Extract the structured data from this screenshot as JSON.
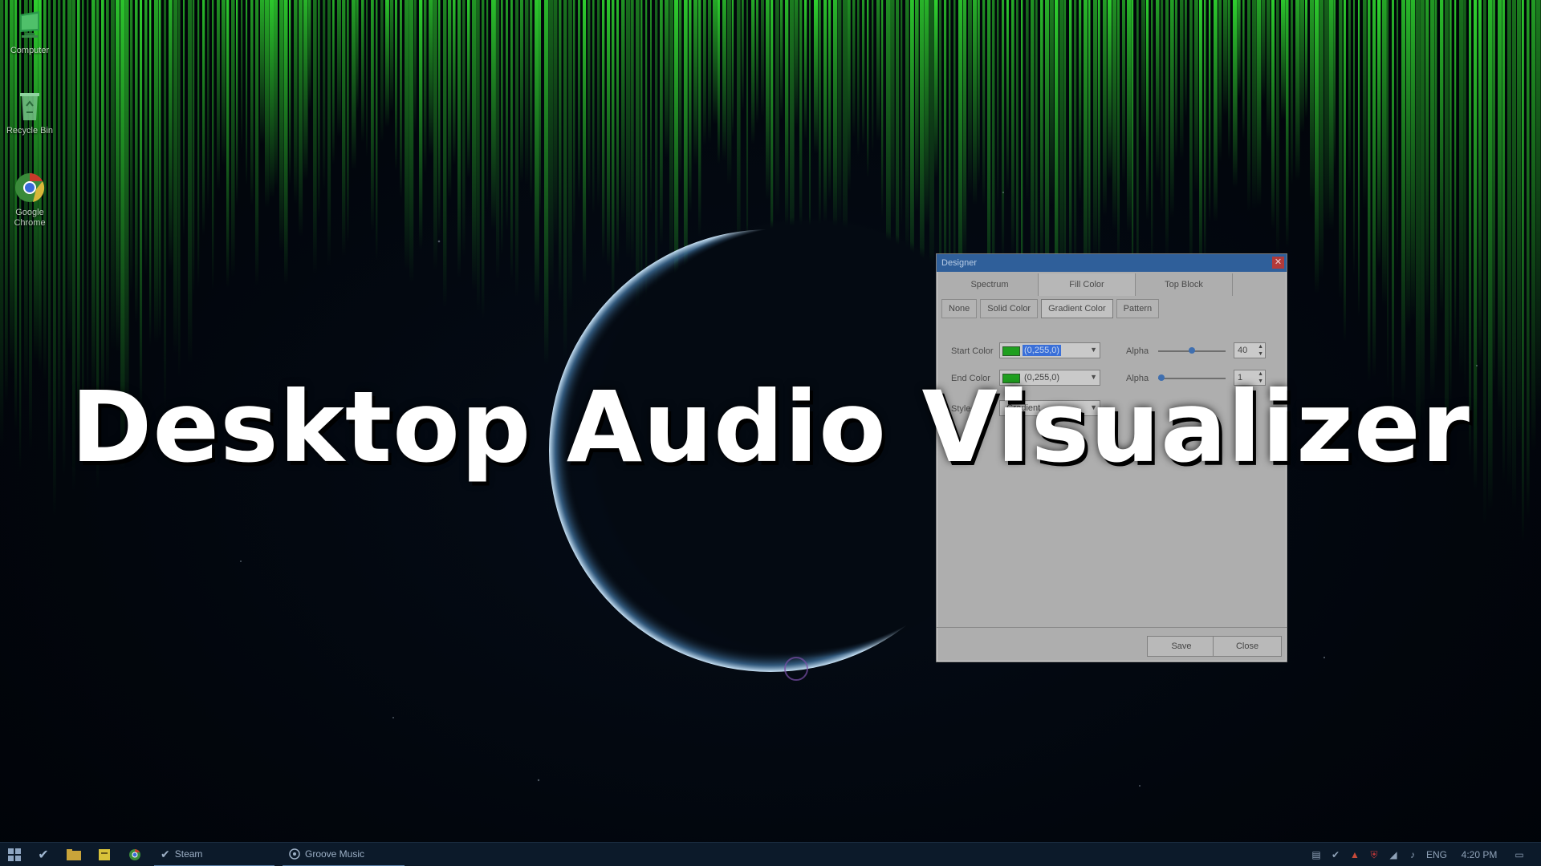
{
  "desktop": {
    "icons": [
      {
        "label": "Computer",
        "icon": "computer-icon"
      },
      {
        "label": "Recycle Bin",
        "icon": "recycle-bin-icon"
      },
      {
        "label": "Google Chrome",
        "icon": "chrome-icon"
      }
    ],
    "accent_color": "#2fd32f",
    "background_color": "#02060d"
  },
  "designer": {
    "title": "Designer",
    "tabs": [
      "Spectrum",
      "Fill Color",
      "Top Block"
    ],
    "active_tab": "Fill Color",
    "fill_modes": [
      "None",
      "Solid Color",
      "Gradient Color",
      "Pattern"
    ],
    "active_fill_mode": "Gradient Color",
    "start_color_label": "Start Color",
    "start_color_value": "(0,255,0)",
    "end_color_label": "End Color",
    "end_color_value": "(0,255,0)",
    "alpha_label": "Alpha",
    "start_alpha": "40",
    "end_alpha": "1",
    "style_label": "Style",
    "style_value": "Gradient",
    "save_label": "Save",
    "close_label": "Close"
  },
  "overlay": {
    "title": "Desktop Audio Visualizer"
  },
  "taskbar": {
    "apps": [
      {
        "label": "Steam",
        "icon": "steam-icon"
      },
      {
        "label": "Groove Music",
        "icon": "groove-music-icon"
      }
    ],
    "language": "ENG",
    "time": "4:20 PM"
  }
}
